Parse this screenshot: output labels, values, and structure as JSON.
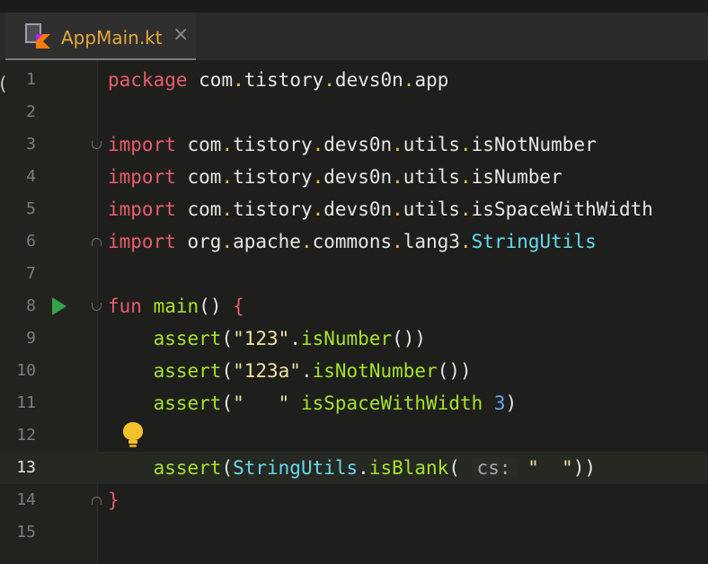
{
  "tab": {
    "label": "AppMain.kt",
    "close": "×"
  },
  "gutter_left_glyph": "(",
  "lines": [
    {
      "n": "1",
      "segments": [
        {
          "t": "package",
          "c": "kw"
        },
        {
          "t": " com"
        },
        {
          "t": ".",
          "c": "dot"
        },
        {
          "t": "tistory"
        },
        {
          "t": ".",
          "c": "dot"
        },
        {
          "t": "devs0n"
        },
        {
          "t": ".",
          "c": "dot"
        },
        {
          "t": "app"
        }
      ]
    },
    {
      "n": "2",
      "segments": []
    },
    {
      "n": "3",
      "fold": "open",
      "segments": [
        {
          "t": "import",
          "c": "kw"
        },
        {
          "t": " com"
        },
        {
          "t": ".",
          "c": "dot"
        },
        {
          "t": "tistory"
        },
        {
          "t": ".",
          "c": "dot"
        },
        {
          "t": "devs0n"
        },
        {
          "t": ".",
          "c": "dot"
        },
        {
          "t": "utils"
        },
        {
          "t": ".",
          "c": "dot"
        },
        {
          "t": "isNotNumber"
        }
      ]
    },
    {
      "n": "4",
      "segments": [
        {
          "t": "import",
          "c": "kw"
        },
        {
          "t": " com"
        },
        {
          "t": ".",
          "c": "dot"
        },
        {
          "t": "tistory"
        },
        {
          "t": ".",
          "c": "dot"
        },
        {
          "t": "devs0n"
        },
        {
          "t": ".",
          "c": "dot"
        },
        {
          "t": "utils"
        },
        {
          "t": ".",
          "c": "dot"
        },
        {
          "t": "isNumber"
        }
      ]
    },
    {
      "n": "5",
      "segments": [
        {
          "t": "import",
          "c": "kw"
        },
        {
          "t": " com"
        },
        {
          "t": ".",
          "c": "dot"
        },
        {
          "t": "tistory"
        },
        {
          "t": ".",
          "c": "dot"
        },
        {
          "t": "devs0n"
        },
        {
          "t": ".",
          "c": "dot"
        },
        {
          "t": "utils"
        },
        {
          "t": ".",
          "c": "dot"
        },
        {
          "t": "isSpaceWithWidth"
        }
      ]
    },
    {
      "n": "6",
      "fold": "close",
      "segments": [
        {
          "t": "import",
          "c": "kw"
        },
        {
          "t": " org"
        },
        {
          "t": ".",
          "c": "dot"
        },
        {
          "t": "apache"
        },
        {
          "t": ".",
          "c": "dot"
        },
        {
          "t": "commons"
        },
        {
          "t": ".",
          "c": "dot"
        },
        {
          "t": "lang3"
        },
        {
          "t": ".",
          "c": "dot"
        },
        {
          "t": "StringUtils",
          "c": "cls"
        }
      ]
    },
    {
      "n": "7",
      "segments": []
    },
    {
      "n": "8",
      "fold": "open",
      "run": true,
      "segments": [
        {
          "t": "fun",
          "c": "kw"
        },
        {
          "t": " "
        },
        {
          "t": "main",
          "c": "fn"
        },
        {
          "t": "() "
        },
        {
          "t": "{",
          "c": "kw"
        }
      ]
    },
    {
      "n": "9",
      "segments": [
        {
          "t": "    "
        },
        {
          "t": "assert",
          "c": "fn"
        },
        {
          "t": "("
        },
        {
          "t": "\"123\"",
          "c": "str"
        },
        {
          "t": "."
        },
        {
          "t": "isNumber",
          "c": "fn"
        },
        {
          "t": "())"
        }
      ]
    },
    {
      "n": "10",
      "segments": [
        {
          "t": "    "
        },
        {
          "t": "assert",
          "c": "fn"
        },
        {
          "t": "("
        },
        {
          "t": "\"123a\"",
          "c": "str"
        },
        {
          "t": "."
        },
        {
          "t": "isNotNumber",
          "c": "fn"
        },
        {
          "t": "())"
        }
      ]
    },
    {
      "n": "11",
      "segments": [
        {
          "t": "    "
        },
        {
          "t": "assert",
          "c": "fn"
        },
        {
          "t": "("
        },
        {
          "t": "\"   \"",
          "c": "str"
        },
        {
          "t": " "
        },
        {
          "t": "isSpaceWithWidth",
          "c": "fn"
        },
        {
          "t": " "
        },
        {
          "t": "3",
          "c": "num"
        },
        {
          "t": ")"
        }
      ]
    },
    {
      "n": "12",
      "bulb": true,
      "segments": []
    },
    {
      "n": "13",
      "current": true,
      "segments": [
        {
          "t": "    "
        },
        {
          "t": "assert",
          "c": "fn"
        },
        {
          "t": "("
        },
        {
          "t": "StringUtils",
          "c": "cls"
        },
        {
          "t": "."
        },
        {
          "t": "isBlank",
          "c": "fn"
        },
        {
          "t": "( "
        },
        {
          "t": "cs:",
          "c": "hint"
        },
        {
          "t": " "
        },
        {
          "t": "\"  \"",
          "c": "str"
        },
        {
          "t": "))"
        }
      ]
    },
    {
      "n": "14",
      "fold": "close",
      "segments": [
        {
          "t": "}",
          "c": "kw"
        }
      ]
    },
    {
      "n": "15",
      "segments": []
    }
  ]
}
